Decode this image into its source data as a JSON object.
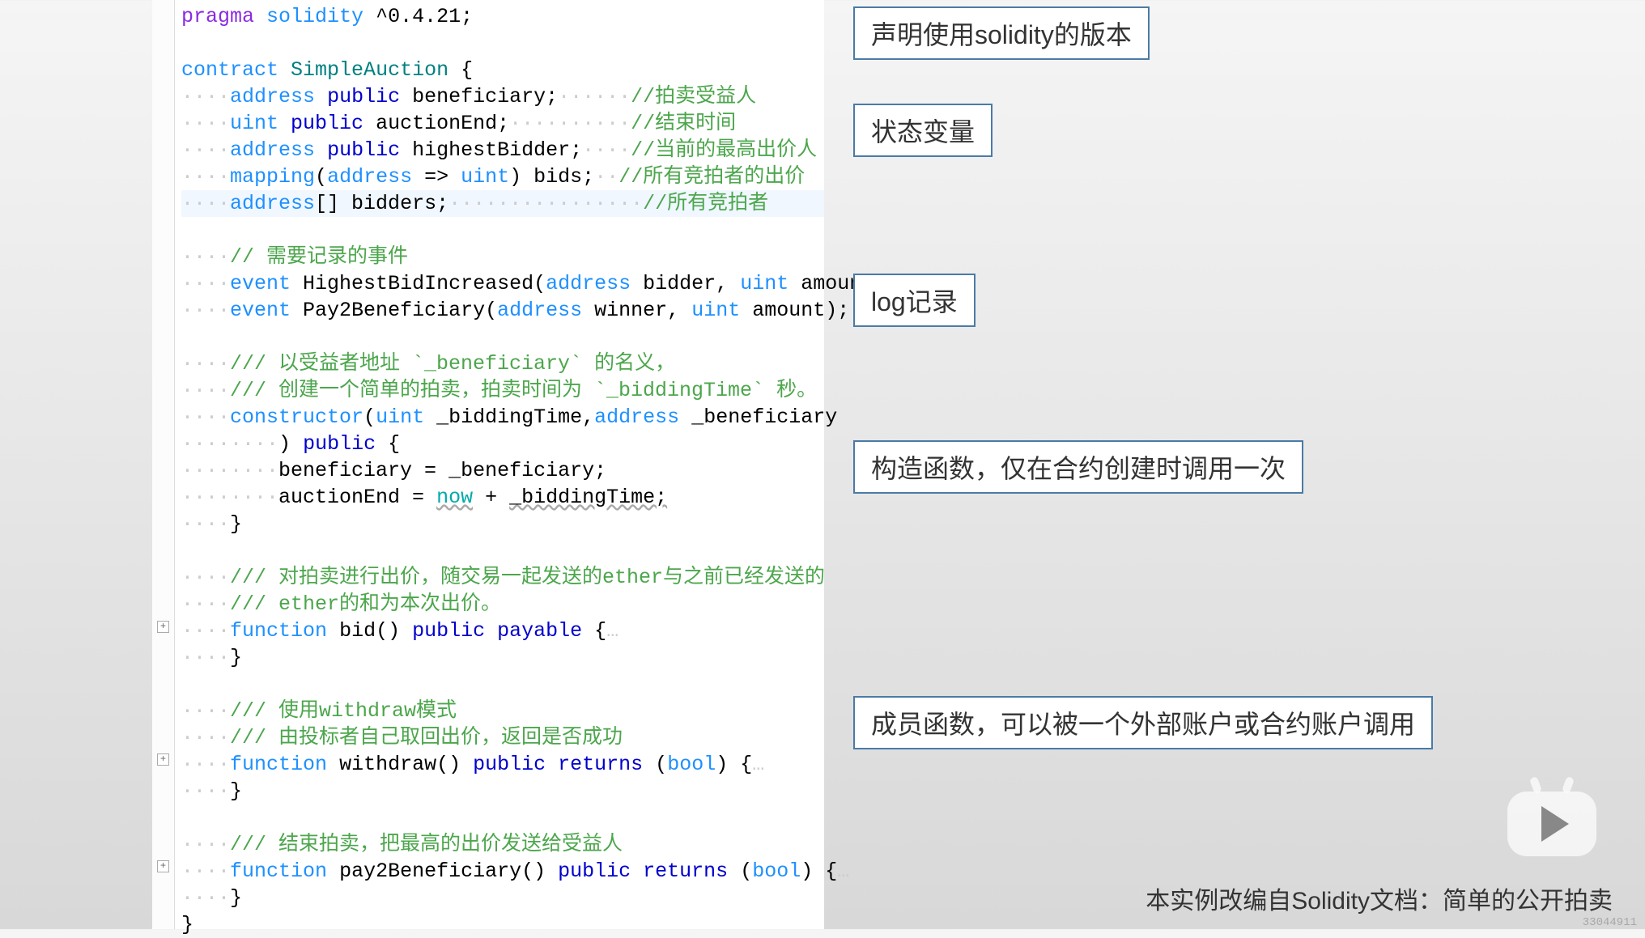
{
  "annotations": {
    "pragma": "声明使用solidity的版本",
    "state_vars": "状态变量",
    "log": "log记录",
    "constructor": "构造函数，仅在合约创建时调用一次",
    "members": "成员函数，可以被一个外部账户或合约账户调用"
  },
  "footer": "本实例改编自Solidity文档：简单的公开拍卖",
  "watermark": "33044911",
  "code": {
    "l1_pragma": "pragma",
    "l1_solidity": "solidity",
    "l1_ver": "^0.4.21;",
    "l3_contract": "contract",
    "l3_name": "SimpleAuction",
    "l3_brace": "{",
    "l4_a": "address",
    "l4_p": "public",
    "l4_n": "beneficiary;",
    "l4_c": "//拍卖受益人",
    "l5_a": "uint",
    "l5_p": "public",
    "l5_n": "auctionEnd;",
    "l5_c": "//结束时间",
    "l6_a": "address",
    "l6_p": "public",
    "l6_n": "highestBidder;",
    "l6_c": "//当前的最高出价人",
    "l7_map": "mapping",
    "l7_addr": "address",
    "l7_arrow": "=>",
    "l7_uint": "uint",
    "l7_bids": ") bids;",
    "l7_c": "//所有竞拍者的出价",
    "l8_a": "address",
    "l8_n": "[] bidders;",
    "l8_c": "//所有竞拍者",
    "l10_c": "// 需要记录的事件",
    "l11_ev": "event",
    "l11_name": "HighestBidIncreased(",
    "l11_t1": "address",
    "l11_p1": "bidder,",
    "l11_t2": "uint",
    "l11_p2": "amount);",
    "l12_ev": "event",
    "l12_name": "Pay2Beneficiary(",
    "l12_t1": "address",
    "l12_p1": "winner,",
    "l12_t2": "uint",
    "l12_p2": "amount);",
    "l14_c": "/// 以受益者地址 `_beneficiary` 的名义，",
    "l15_c": "/// 创建一个简单的拍卖，拍卖时间为 `_biddingTime` 秒。",
    "l16_kw": "constructor",
    "l16_t1": "uint",
    "l16_p1": "_biddingTime,",
    "l16_t2": "address",
    "l16_p2": "_beneficiary",
    "l17_paren": ")",
    "l17_pub": "public",
    "l17_brace": "{",
    "l18": "beneficiary = _beneficiary;",
    "l19_a": "auctionEnd = ",
    "l19_now": "now",
    "l19_plus": " + ",
    "l19_bt": "_biddingTime;",
    "l20": "}",
    "l22_c": "/// 对拍卖进行出价，随交易一起发送的ether与之前已经发送的",
    "l23_c": "/// ether的和为本次出价。",
    "l24_fn": "function",
    "l24_name": "bid()",
    "l24_pub": "public",
    "l24_pay": "payable",
    "l24_brace": "{",
    "l24_dots": "…",
    "l25": "}",
    "l27_c": "/// 使用withdraw模式",
    "l28_c": "/// 由投标者自己取回出价，返回是否成功",
    "l29_fn": "function",
    "l29_name": "withdraw()",
    "l29_pub": "public",
    "l29_ret": "returns",
    "l29_bool": "bool",
    "l29_brace": ") {",
    "l29_dots": "…",
    "l30": "}",
    "l32_c": "/// 结束拍卖，把最高的出价发送给受益人",
    "l33_fn": "function",
    "l33_name": "pay2Beneficiary()",
    "l33_pub": "public",
    "l33_ret": "returns",
    "l33_bool": "bool",
    "l33_brace": ") {",
    "l33_dots": "…",
    "l34": "}",
    "l35": "}"
  }
}
